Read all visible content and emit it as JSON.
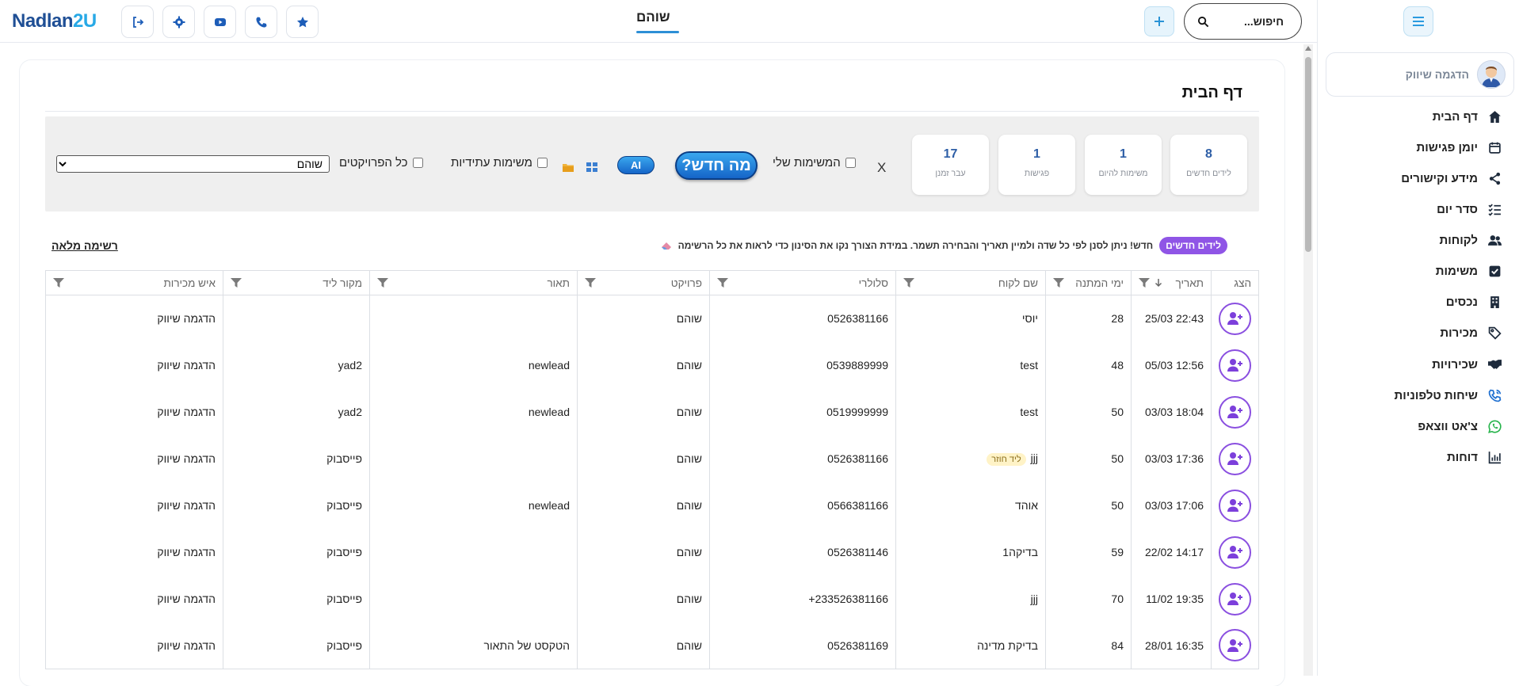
{
  "topbar": {
    "logo_main": "Nadlan",
    "logo_accent": "2U",
    "page_title": "שוהם",
    "search_placeholder": "חיפוש...",
    "icons": [
      "logout-icon",
      "gear-icon",
      "youtube-icon",
      "phone-icon",
      "star-icon"
    ]
  },
  "sidebar": {
    "user_name": "הדגמה שיווק",
    "items": [
      {
        "label": "דף הבית",
        "icon": "home-icon"
      },
      {
        "label": "יומן פגישות",
        "icon": "calendar-icon"
      },
      {
        "label": "מידע וקישורים",
        "icon": "share-icon"
      },
      {
        "label": "סדר יום",
        "icon": "checklist-icon"
      },
      {
        "label": "לקוחות",
        "icon": "users-icon"
      },
      {
        "label": "משימות",
        "icon": "check-square-icon"
      },
      {
        "label": "נכסים",
        "icon": "building-icon"
      },
      {
        "label": "מכירות",
        "icon": "tag-icon"
      },
      {
        "label": "שכירויות",
        "icon": "handshake-icon"
      },
      {
        "label": "שיחות טלפוניות",
        "icon": "phone-call-icon"
      },
      {
        "label": "צ'אט ווצאפ",
        "icon": "whatsapp-icon"
      },
      {
        "label": "דוחות",
        "icon": "chart-icon"
      }
    ]
  },
  "main": {
    "title": "דף הבית",
    "stats": [
      {
        "num": "8",
        "label": "לידים חדשים"
      },
      {
        "num": "1",
        "label": "משימות להיום"
      },
      {
        "num": "1",
        "label": "פגישות"
      },
      {
        "num": "17",
        "label": "עבר זמנן"
      }
    ],
    "close_label": "X",
    "my_tasks_label": "המשימות שלי",
    "whats_new_label": "מה חדש?",
    "ai_label": "AI",
    "future_tasks_label": "משימות עתידיות",
    "all_projects_label": "כל הפרויקטים",
    "project_selected": "שוהם",
    "full_list_label": "רשימה מלאה",
    "new_leads_badge": "לידים חדשים",
    "notice_text": "חדש! ניתן לסנן לפי כל שדה ולמיין תאריך והבחירה תשמר. במידת הצורך נקו את הסינון כדי לראות את כל הרשימה"
  },
  "table": {
    "headers": [
      "הצג",
      "תאריך",
      "ימי המתנה",
      "שם לקוח",
      "סלולרי",
      "פרויקט",
      "תאור",
      "מקור ליד",
      "איש מכירות"
    ],
    "rows": [
      {
        "date": "22:43 25/03",
        "wait": "28",
        "name": "יוסי",
        "tag": "",
        "phone": "0526381166",
        "project": "שוהם",
        "desc": "",
        "source": "",
        "agent": "הדגמה שיווק"
      },
      {
        "date": "12:56 05/03",
        "wait": "48",
        "name": "test",
        "tag": "",
        "phone": "0539889999",
        "project": "שוהם",
        "desc": "newlead",
        "source": "yad2",
        "agent": "הדגמה שיווק"
      },
      {
        "date": "18:04 03/03",
        "wait": "50",
        "name": "test",
        "tag": "",
        "phone": "0519999999",
        "project": "שוהם",
        "desc": "newlead",
        "source": "yad2",
        "agent": "הדגמה שיווק"
      },
      {
        "date": "17:36 03/03",
        "wait": "50",
        "name": "jjj",
        "tag": "ליד חוזר",
        "phone": "0526381166",
        "project": "שוהם",
        "desc": "",
        "source": "פייסבוק",
        "agent": "הדגמה שיווק"
      },
      {
        "date": "17:06 03/03",
        "wait": "50",
        "name": "אוהד",
        "tag": "",
        "phone": "0566381166",
        "project": "שוהם",
        "desc": "newlead",
        "source": "פייסבוק",
        "agent": "הדגמה שיווק"
      },
      {
        "date": "14:17 22/02",
        "wait": "59",
        "name": "בדיקה1",
        "tag": "",
        "phone": "0526381146",
        "project": "שוהם",
        "desc": "",
        "source": "פייסבוק",
        "agent": "הדגמה שיווק"
      },
      {
        "date": "19:35 11/02",
        "wait": "70",
        "name": "jjj",
        "tag": "",
        "phone": "233526381166+",
        "project": "שוהם",
        "desc": "",
        "source": "פייסבוק",
        "agent": "הדגמה שיווק"
      },
      {
        "date": "16:35 28/01",
        "wait": "84",
        "name": "בדיקת מדינה",
        "tag": "",
        "phone": "0526381169",
        "project": "שוהם",
        "desc": "הטקסט של התאור",
        "source": "פייסבוק",
        "agent": "הדגמה שיווק"
      }
    ]
  },
  "colors": {
    "brand": "#1f4f95",
    "accent": "#2b9be0",
    "purple": "#8a4fe0"
  }
}
